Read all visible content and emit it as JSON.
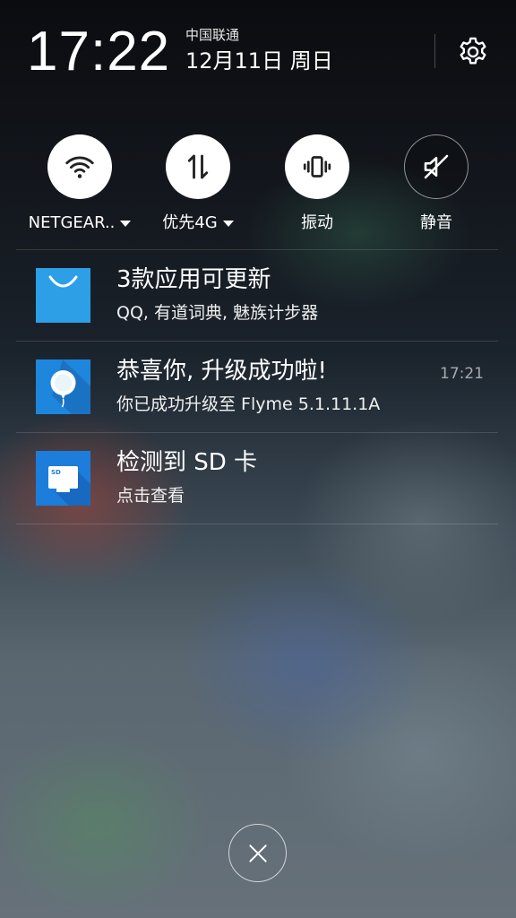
{
  "header": {
    "time": "17:22",
    "carrier": "中国联通",
    "date": "12月11日 周日"
  },
  "toggles": [
    {
      "label": "NETGEAR..",
      "icon": "wifi-icon",
      "state": "on",
      "has_dropdown": true
    },
    {
      "label": "优先4G",
      "icon": "mobile-data-icon",
      "state": "on",
      "has_dropdown": true
    },
    {
      "label": "振动",
      "icon": "vibrate-icon",
      "state": "on",
      "has_dropdown": false
    },
    {
      "label": "静音",
      "icon": "mute-icon",
      "state": "off",
      "has_dropdown": false
    }
  ],
  "notifications": [
    {
      "title": "3款应用可更新",
      "subtitle": "QQ, 有道词典, 魅族计步器",
      "time": "",
      "icon": "app-store-icon"
    },
    {
      "title": "恭喜你, 升级成功啦!",
      "subtitle": "你已成功升级至 Flyme 5.1.11.1A",
      "time": "17:21",
      "icon": "system-update-balloon-icon"
    },
    {
      "title": "检测到 SD 卡",
      "subtitle": "点击查看",
      "time": "",
      "icon": "sd-card-icon",
      "icon_text": "SD"
    }
  ],
  "colors": {
    "app_store_blue": "#2c9fe6",
    "update_blue": "#1e86dc",
    "sd_blue": "#1c7ddb"
  }
}
